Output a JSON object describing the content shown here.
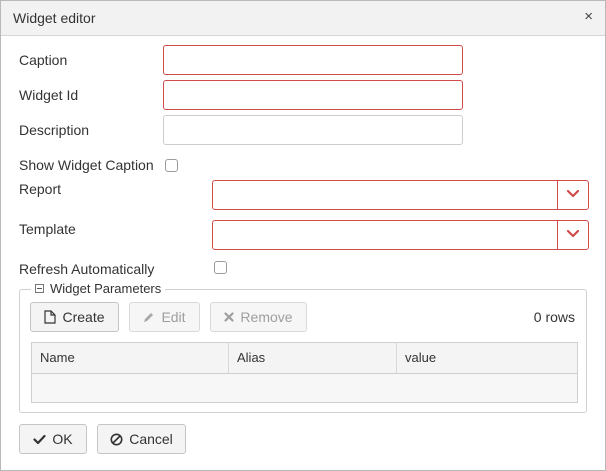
{
  "dialog": {
    "title": "Widget editor",
    "close_glyph": "×"
  },
  "form": {
    "caption_label": "Caption",
    "caption_value": "",
    "widget_id_label": "Widget Id",
    "widget_id_value": "",
    "description_label": "Description",
    "description_value": "",
    "show_caption_label": "Show Widget Caption",
    "show_caption_checked": false,
    "report_label": "Report",
    "report_value": "",
    "template_label": "Template",
    "template_value": "",
    "refresh_label": "Refresh Automatically",
    "refresh_checked": false
  },
  "parameters": {
    "legend": "Widget Parameters",
    "create_label": "Create",
    "edit_label": "Edit",
    "remove_label": "Remove",
    "rows_count": "0 rows",
    "columns": [
      "Name",
      "Alias",
      "value"
    ],
    "rows": []
  },
  "footer": {
    "ok_label": "OK",
    "cancel_label": "Cancel"
  },
  "colors": {
    "error_border": "#d24b4b",
    "titlebar_bg": "#f2f2f2"
  }
}
